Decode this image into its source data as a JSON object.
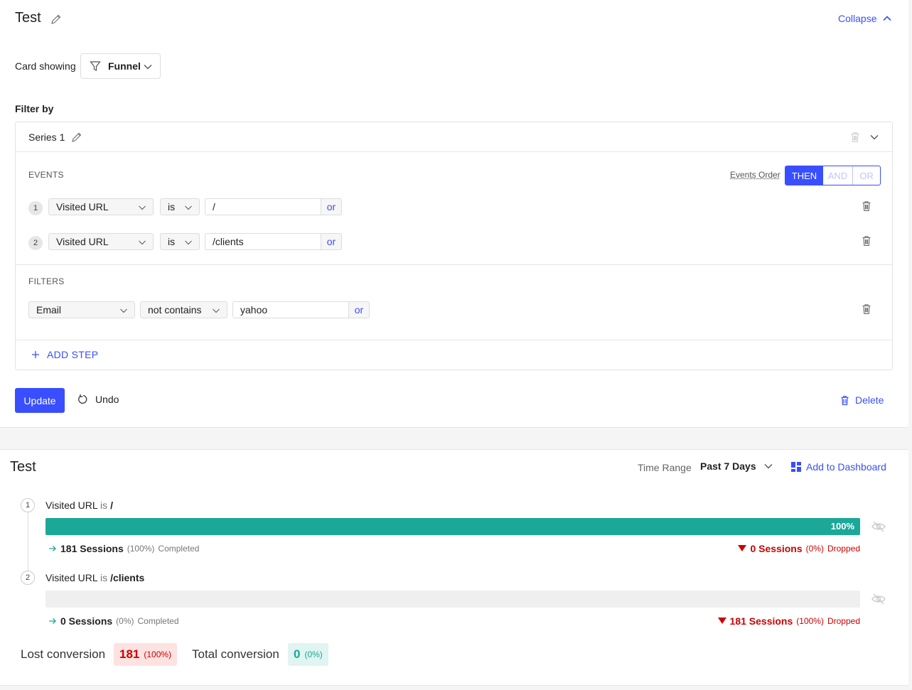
{
  "editor": {
    "title": "Test",
    "collapse_label": "Collapse",
    "card_showing_label": "Card showing",
    "card_type": "Funnel",
    "filter_by_label": "Filter by",
    "series_name": "Series 1",
    "events_label": "EVENTS",
    "events_order_label": "Events Order",
    "order_options": [
      "THEN",
      "AND",
      "OR"
    ],
    "events": [
      {
        "num": "1",
        "field": "Visited URL",
        "operator": "is",
        "value": "/",
        "or_label": "or"
      },
      {
        "num": "2",
        "field": "Visited URL",
        "operator": "is",
        "value": "/clients",
        "or_label": "or"
      }
    ],
    "filters_label": "FILTERS",
    "filters": [
      {
        "field": "Email",
        "operator": "not contains",
        "value": "yahoo",
        "or_label": "or"
      }
    ],
    "add_step_label": "ADD STEP",
    "update_label": "Update",
    "undo_label": "Undo",
    "delete_label": "Delete"
  },
  "funnel": {
    "title": "Test",
    "time_range_label": "Time Range",
    "time_range_value": "Past 7 Days",
    "add_to_dashboard_label": "Add to Dashboard",
    "steps": [
      {
        "num": "1",
        "field": "Visited URL",
        "op": "is",
        "value": "/",
        "fill_percent": 100,
        "bar_label": "100%",
        "completed_sessions": "181 Sessions",
        "completed_pct": "(100%)",
        "completed_label": "Completed",
        "dropped_sessions": "0 Sessions",
        "dropped_pct": "(0%)",
        "dropped_label": "Dropped"
      },
      {
        "num": "2",
        "field": "Visited URL",
        "op": "is",
        "value": "/clients",
        "fill_percent": 0,
        "bar_label": "",
        "completed_sessions": "0 Sessions",
        "completed_pct": "(0%)",
        "completed_label": "Completed",
        "dropped_sessions": "181 Sessions",
        "dropped_pct": "(100%)",
        "dropped_label": "Dropped"
      }
    ],
    "lost_conversion_label": "Lost conversion",
    "lost_conversion_value": "181",
    "lost_conversion_pct": "(100%)",
    "total_conversion_label": "Total conversion",
    "total_conversion_value": "0",
    "total_conversion_pct": "(0%)"
  },
  "colors": {
    "accent": "#394eff",
    "bar": "#1ba899",
    "dropped": "#cc0000",
    "lost_bg": "#fde2e2",
    "total_bg": "#e0f4f1"
  }
}
